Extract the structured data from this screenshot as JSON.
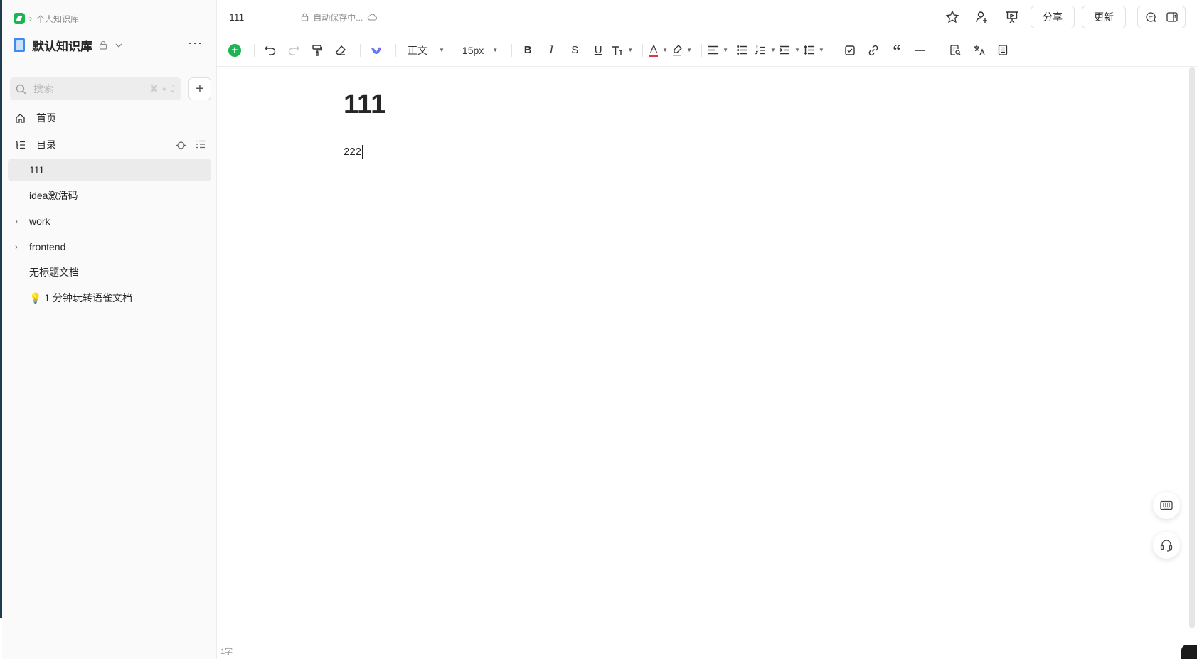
{
  "sidebar": {
    "breadcrumb": "个人知识库",
    "library_name": "默认知识库",
    "search_placeholder": "搜索",
    "search_shortcut": "⌘ + J",
    "nav": {
      "home": "首页",
      "toc": "目录"
    },
    "docs": [
      {
        "label": "111",
        "active": true,
        "expandable": false
      },
      {
        "label": "idea激活码",
        "active": false,
        "expandable": false
      },
      {
        "label": "work",
        "active": false,
        "expandable": true
      },
      {
        "label": "frontend",
        "active": false,
        "expandable": true
      },
      {
        "label": "无标题文档",
        "active": false,
        "expandable": false
      },
      {
        "label": "💡 1 分钟玩转语雀文档",
        "active": false,
        "expandable": false
      }
    ]
  },
  "header": {
    "doc_title": "111",
    "save_status": "自动保存中...",
    "share_label": "分享",
    "update_label": "更新"
  },
  "toolbar": {
    "paragraph_style": "正文",
    "font_size": "15px"
  },
  "editor": {
    "title": "111",
    "body": "222",
    "word_count": "1字"
  },
  "colors": {
    "accent_green": "#1fb355",
    "library_icon_blue": "#3d8bf2",
    "active_item_bg": "#ebebeb"
  }
}
